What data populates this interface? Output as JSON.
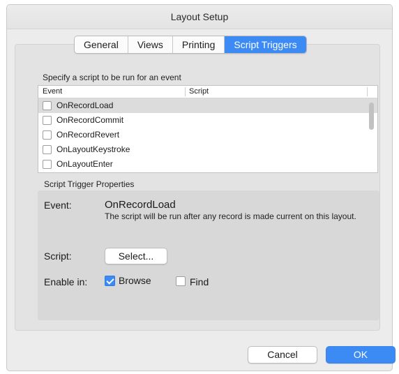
{
  "window": {
    "title": "Layout Setup"
  },
  "tabs": [
    {
      "label": "General"
    },
    {
      "label": "Views"
    },
    {
      "label": "Printing"
    },
    {
      "label": "Script Triggers",
      "active": true
    }
  ],
  "instruction": "Specify a script to be run for an event",
  "table": {
    "headers": {
      "event": "Event",
      "script": "Script"
    },
    "rows": [
      {
        "event": "OnRecordLoad",
        "checked": false,
        "selected": true
      },
      {
        "event": "OnRecordCommit",
        "checked": false
      },
      {
        "event": "OnRecordRevert",
        "checked": false
      },
      {
        "event": "OnLayoutKeystroke",
        "checked": false
      },
      {
        "event": "OnLayoutEnter",
        "checked": false
      }
    ]
  },
  "properties": {
    "title": "Script Trigger Properties",
    "event_label": "Event:",
    "event_name": "OnRecordLoad",
    "event_description": "The script will be run after any record is made current on this layout.",
    "script_label": "Script:",
    "select_button": "Select...",
    "enable_label": "Enable in:",
    "browse": {
      "label": "Browse",
      "checked": true
    },
    "find": {
      "label": "Find",
      "checked": false
    }
  },
  "buttons": {
    "cancel": "Cancel",
    "ok": "OK"
  },
  "colors": {
    "accent": "#3c8af3",
    "selected_row": "#dcdcdc"
  }
}
